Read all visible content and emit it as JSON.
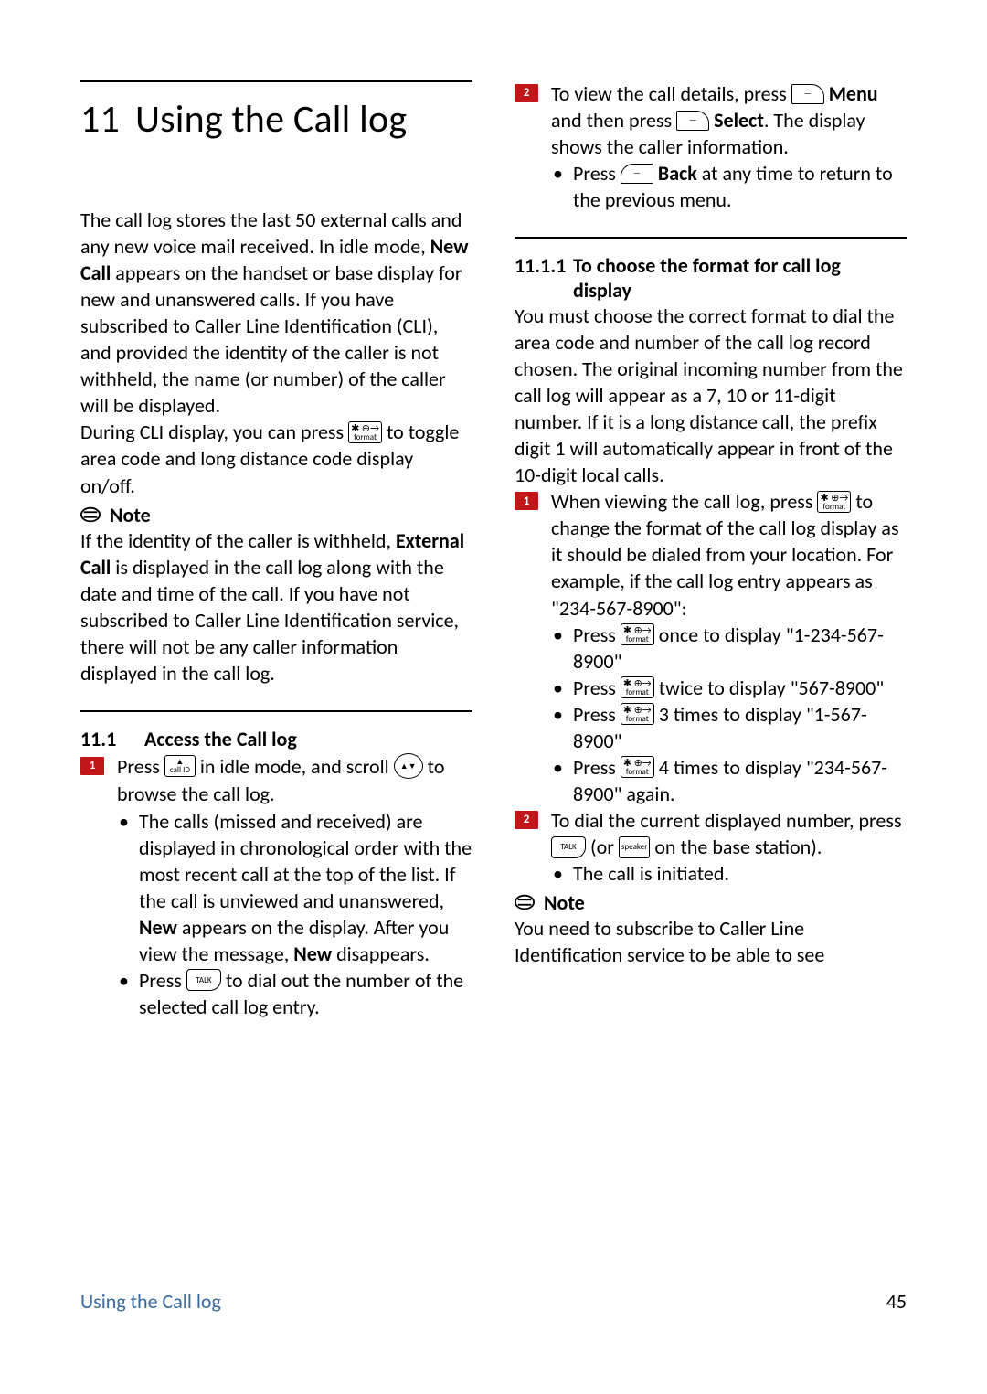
{
  "chapter": {
    "num": "11",
    "title": "Using the Call log"
  },
  "intro_p1_a": "The call log stores the last 50 external calls and any new voice mail received. In idle mode, ",
  "intro_p1_bold": "New Call",
  "intro_p1_b": " appears on the handset or base display for new and unanswered calls. If you have subscribed to Caller Line Identification (CLI), and provided the identity of the caller is not withheld, the name (or number) of the caller will be displayed.",
  "intro_p2_a": "During CLI display, you can press ",
  "intro_p2_b": " to toggle area code and long distance code display on/off.",
  "note_label": "Note",
  "note1_a": "If the identity of the caller is withheld, ",
  "note1_bold": "External Call",
  "note1_b": " is displayed in the call log along with the date and time of the call. If you have not subscribed to Caller Line Identification service, there will not be any caller information displayed in the call log.",
  "sec11_1": {
    "num": "11.1",
    "title": "Access the Call log"
  },
  "s11_1_step1_a": "Press ",
  "s11_1_step1_b": " in idle mode, and scroll ",
  "s11_1_step1_c": " to browse the call log.",
  "s11_1_b1_a": "The calls (missed and received) are displayed in chronological order with the most recent call at the top of the list. If the call is unviewed and unanswered, ",
  "s11_1_b1_bold1": "New",
  "s11_1_b1_b": " appears on the display. After you view the message, ",
  "s11_1_b1_bold2": "New",
  "s11_1_b1_c": " disappears.",
  "s11_1_b2_a": "Press ",
  "s11_1_b2_b": " to dial out the number of the selected call log entry.",
  "s11_1_step2_a": "To view the call details, press ",
  "s11_1_step2_menu": "Menu",
  "s11_1_step2_b": " and then press ",
  "s11_1_step2_select": "Select",
  "s11_1_step2_c": ". The display shows the caller information.",
  "s11_1_step2_bullet_a": "Press ",
  "s11_1_step2_bullet_back": "Back",
  "s11_1_step2_bullet_b": " at any time to return to the previous menu.",
  "sec11_1_1": {
    "num": "11.1.1",
    "title": "To choose the format for call log display"
  },
  "s11_1_1_intro": "You must choose the correct format to dial the area code and number of the call log record chosen. The original incoming number from the call log will appear as a 7, 10 or 11-digit number. If it is a long distance call, the prefix digit 1 will automatically appear in front of the 10-digit local calls.",
  "s11_1_1_step1_a": "When viewing the call log, press ",
  "s11_1_1_step1_b": " to change the format of the call log display as it should be dialed from your location. For example, if the call log entry appears as \"234-567-8900\":",
  "s11_1_1_b1_a": "Press ",
  "s11_1_1_b1_b": " once to display \"1-234-567-8900\"",
  "s11_1_1_b2_a": "Press ",
  "s11_1_1_b2_b": " twice to display \"567-8900\"",
  "s11_1_1_b3_a": "Press ",
  "s11_1_1_b3_b": " 3 times to display \"1-567-8900\"",
  "s11_1_1_b4_a": "Press ",
  "s11_1_1_b4_b": " 4 times to display \"234-567-8900\" again.",
  "s11_1_1_step2_a": "To dial the current displayed number, press ",
  "s11_1_1_step2_b": " (or ",
  "s11_1_1_step2_c": " on the base station).",
  "s11_1_1_step2_bullet": "The call is initiated.",
  "note2": "You need to subscribe to Caller Line Identification service to be able to see",
  "footer": {
    "title": "Using the Call log",
    "page": "45"
  },
  "keys": {
    "format_top": "✱ ⊕→",
    "format_bot": "format",
    "callid_top": "▲",
    "callid_bot": "call ID",
    "nav_round": "▲▼",
    "talk": "TALK",
    "speaker": "speaker",
    "soft_dash": "—"
  }
}
